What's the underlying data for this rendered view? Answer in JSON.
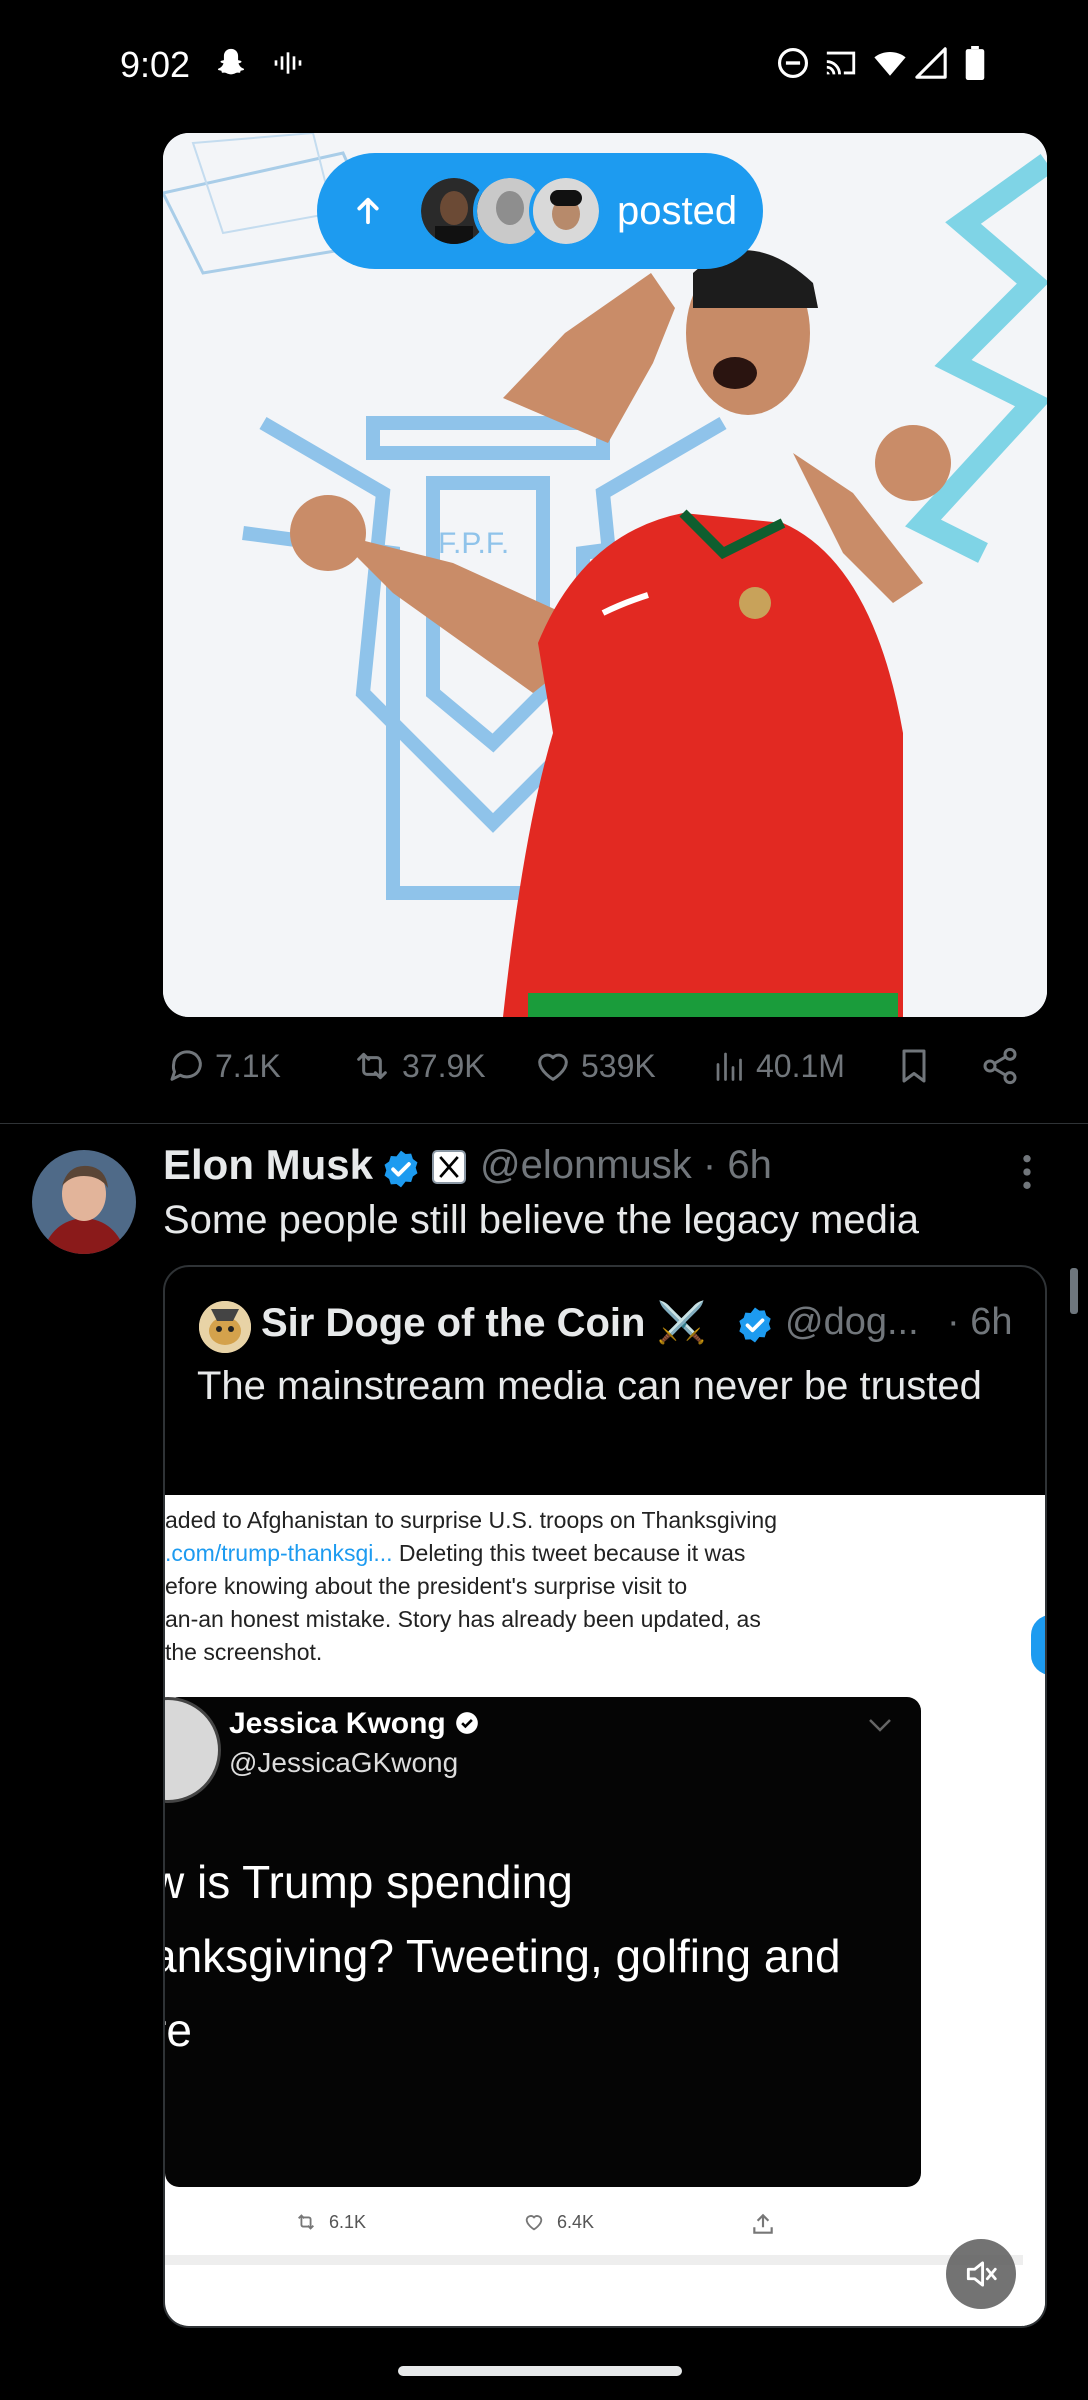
{
  "status_bar": {
    "time": "9:02",
    "icons": [
      "snapchat-icon",
      "voicemail-icon",
      "dnd-icon",
      "cast-icon",
      "wifi-icon",
      "signal-icon",
      "battery-icon"
    ]
  },
  "banner": {
    "label": "posted",
    "icon": "arrow-up-icon"
  },
  "post1": {
    "media_icon": "photo",
    "replies": "7.1K",
    "reposts": "37.9K",
    "likes": "539K",
    "views": "40.1M"
  },
  "post2": {
    "author": "Elon Musk",
    "handle": "@elonmusk",
    "time": "· 6h",
    "text": "Some people still believe the legacy media",
    "quote": {
      "author": "Sir Doge of the Coin ⚔️",
      "handle": "@dog...",
      "time": "· 6h",
      "text": "The mainstream media can never be trusted",
      "screenshot": {
        "lines": [
          "aded to Afghanistan to surprise U.S. troops on Thanksgiving",
          ".com/trump-thanksgi... Deleting this tweet because it was",
          "efore knowing about the president's surprise visit to",
          "an-an honest mistake. Story has already been updated, as",
          "the screenshot."
        ],
        "inner_name": "Jessica Kwong",
        "inner_handle": "@JessicaGKwong",
        "video_lines": [
          "w is Trump spending",
          "anksgiving? Tweeting, golfing and",
          "re"
        ],
        "retweets": "6.1K",
        "likes": "6.4K"
      }
    }
  },
  "colors": {
    "accent": "#1d9bf0",
    "muted": "#71767b",
    "background": "#000000"
  }
}
